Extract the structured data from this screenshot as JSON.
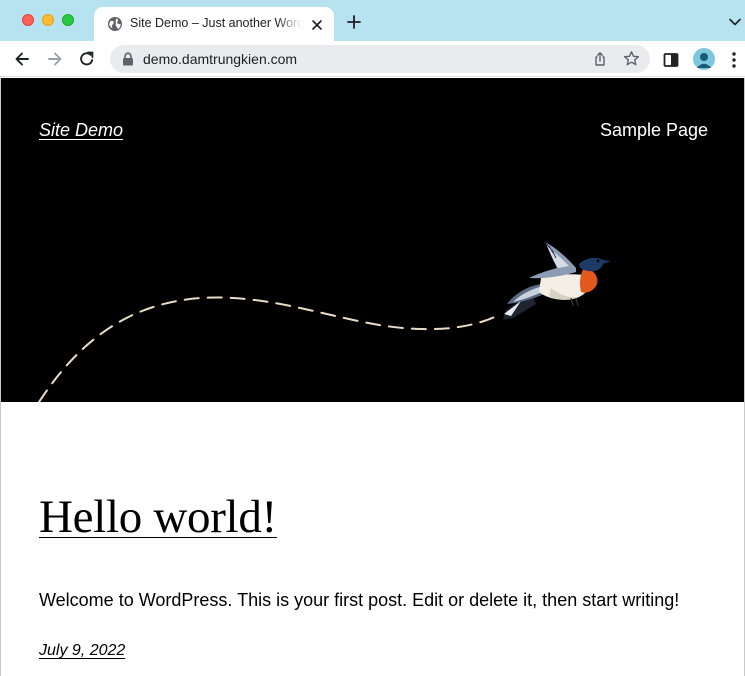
{
  "browser": {
    "tab": {
      "title": "Site Demo – Just another WordPress site",
      "favicon": "globe-icon",
      "close_icon": "close-icon"
    },
    "new_tab_icon": "plus-icon",
    "tab_search_icon": "chevron-down-icon",
    "toolbar": {
      "back_icon": "arrow-left-icon",
      "forward_icon": "arrow-right-icon",
      "reload_icon": "reload-icon",
      "lock_icon": "lock-icon",
      "url": "demo.damtrungkien.com",
      "share_icon": "share-icon",
      "bookmark_icon": "star-icon",
      "side_panel_icon": "side-panel-icon",
      "profile_icon": "avatar-icon",
      "menu_icon": "kebab-menu-icon"
    },
    "colors": {
      "tabstrip": "#b6e3ef",
      "omnibox": "#e9ebee",
      "avatar": "#7cc6de"
    }
  },
  "site": {
    "title": "Site Demo",
    "nav": [
      "Sample Page"
    ],
    "hero_art": "bird-flight-illustration",
    "colors": {
      "header_bg": "#000000",
      "header_text": "#ffffff",
      "flight_path": "#e9dcc6"
    }
  },
  "post": {
    "title": "Hello world!",
    "excerpt": "Welcome to WordPress. This is your first post. Edit or delete it, then start writing!",
    "date": "July 9, 2022"
  }
}
